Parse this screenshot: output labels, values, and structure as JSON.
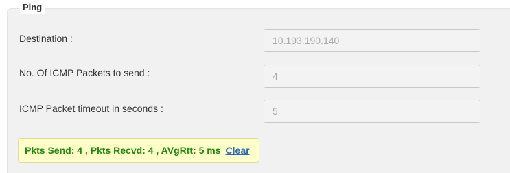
{
  "section": {
    "title": "Ping"
  },
  "fields": [
    {
      "label": "Destination :",
      "value": "10.193.190.140"
    },
    {
      "label": "No. Of ICMP Packets to send :",
      "value": "4"
    },
    {
      "label": "ICMP Packet timeout in seconds :",
      "value": "5"
    }
  ],
  "result": {
    "text": "Pkts Send: 4 , Pkts Recvd: 4 , AVgRtt: 5 ms",
    "clear_label": "Clear"
  },
  "colors": {
    "panel_background": "#f1f1f1",
    "result_background": "#ffffc8",
    "result_text": "#1e8a12",
    "link": "#2b67b7"
  }
}
